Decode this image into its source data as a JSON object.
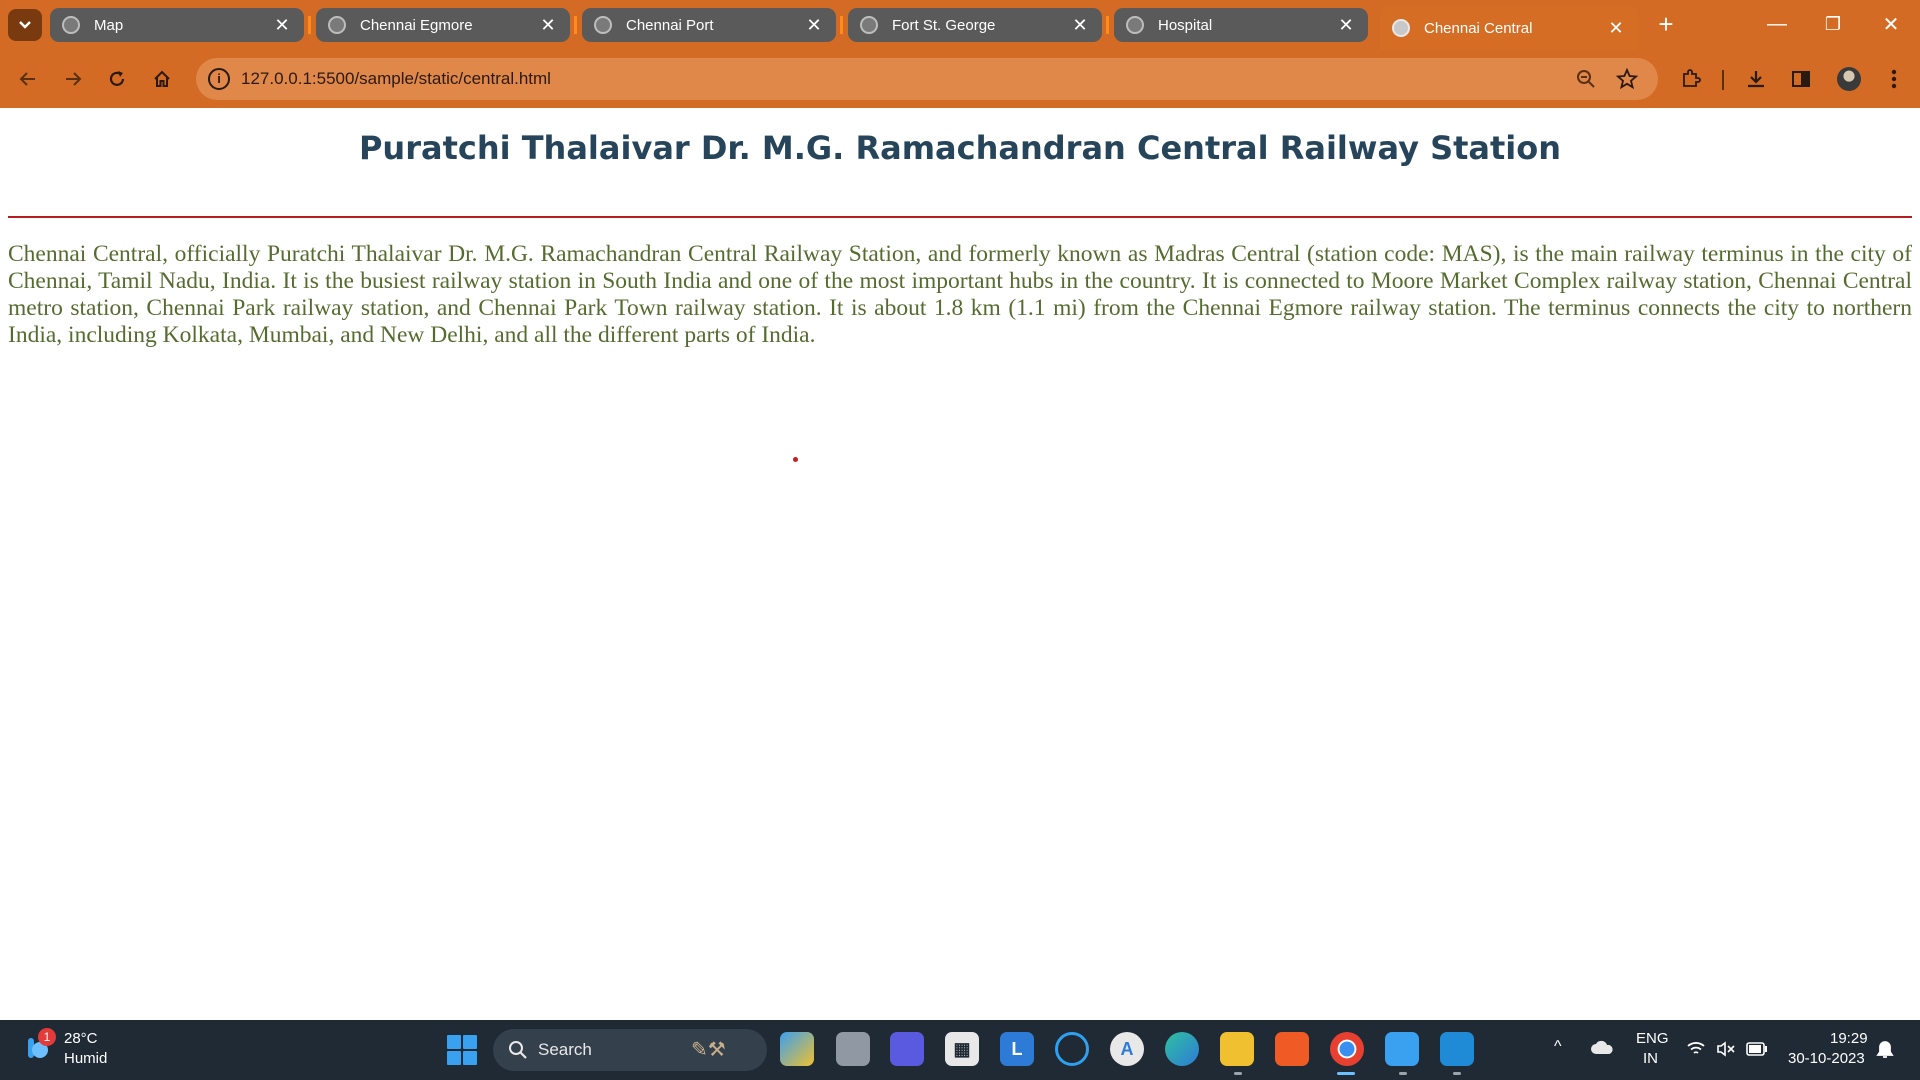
{
  "browser": {
    "tabs": [
      {
        "title": "Map",
        "close": "✕"
      },
      {
        "title": "Chennai Egmore",
        "close": "✕"
      },
      {
        "title": "Chennai Port",
        "close": "✕"
      },
      {
        "title": "Fort St. George",
        "close": "✕"
      },
      {
        "title": "Hospital",
        "close": "✕"
      },
      {
        "title": "Chennai Central",
        "close": "✕",
        "active": true
      }
    ],
    "new_tab": "+",
    "address": "127.0.0.1:5500/sample/static/central.html",
    "info_glyph": "i",
    "window_controls": {
      "minimize": "—",
      "restore": "❐",
      "close": "✕"
    }
  },
  "page": {
    "heading": "Puratchi Thalaivar Dr. M.G. Ramachandran Central Railway Station",
    "paragraph": "Chennai Central, officially Puratchi Thalaivar Dr. M.G. Ramachandran Central Railway Station, and formerly known as Madras Central (station code: MAS), is the main railway terminus in the city of Chennai, Tamil Nadu, India. It is the busiest railway station in South India and one of the most important hubs in the country. It is connected to Moore Market Complex railway station, Chennai Central metro station, Chennai Park railway station, and Chennai Park Town railway station. It is about 1.8 km (1.1 mi) from the Chennai Egmore railway station. The terminus connects the city to northern India, including Kolkata, Mumbai, and New Delhi, and all the different parts of India.",
    "heading_color": "#27455a",
    "text_color": "#556b2f",
    "rule_color": "#b51e1e"
  },
  "taskbar": {
    "weather": {
      "badge": "1",
      "temp": "28°C",
      "desc": "Humid"
    },
    "search_label": "Search",
    "language": {
      "line1": "ENG",
      "line2": "IN"
    },
    "clock": {
      "time": "19:29",
      "date": "30-10-2023"
    },
    "tray_up": "^"
  },
  "colors": {
    "chrome": "#d36b24",
    "taskbar": "#1f2a34"
  }
}
